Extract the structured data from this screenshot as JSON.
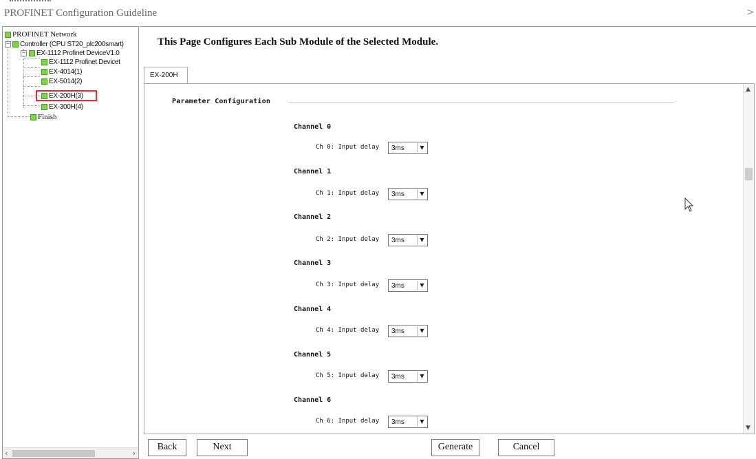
{
  "window": {
    "title": "PROFINET Configuration Guideline",
    "close_glyph": ">"
  },
  "tree": {
    "items": [
      {
        "label": "PROFINET Network"
      },
      {
        "label": "Controller (CPU ST20_plc200smart)"
      },
      {
        "label": "EX-1112 Profinet DeviceV1.0"
      },
      {
        "label": "EX-1112 Profinet Devicet"
      },
      {
        "label": "EX-4014(1)"
      },
      {
        "label": "EX-5014(2)"
      },
      {
        "label": "EX-200H(3)"
      },
      {
        "label": "EX-300H(4)"
      },
      {
        "label": "Finish"
      }
    ],
    "selected": "EX-200H(3)",
    "highlight_color": "#e03030"
  },
  "main": {
    "heading": "This Page Configures Each Sub Module of the Selected Module.",
    "tab_label": "EX-200H",
    "section_title": "Parameter Configuration",
    "channels": [
      {
        "title": "Channel 0",
        "label": "Ch 0: Input delay",
        "value": "3ms"
      },
      {
        "title": "Channel 1",
        "label": "Ch 1: Input delay",
        "value": "3ms"
      },
      {
        "title": "Channel 2",
        "label": "Ch 2: Input delay",
        "value": "3ms"
      },
      {
        "title": "Channel 3",
        "label": "Ch 3: Input delay",
        "value": "3ms"
      },
      {
        "title": "Channel 4",
        "label": "Ch 4: Input delay",
        "value": "3ms"
      },
      {
        "title": "Channel 5",
        "label": "Ch 5: Input delay",
        "value": "3ms"
      },
      {
        "title": "Channel 6",
        "label": "Ch 6: Input delay",
        "value": "3ms"
      }
    ]
  },
  "buttons": {
    "back": "Back",
    "next": "Next",
    "generate": "Generate",
    "cancel": "Cancel"
  },
  "colors": {
    "tree_icon": "#7fd24a",
    "border": "#9a9a9a"
  }
}
